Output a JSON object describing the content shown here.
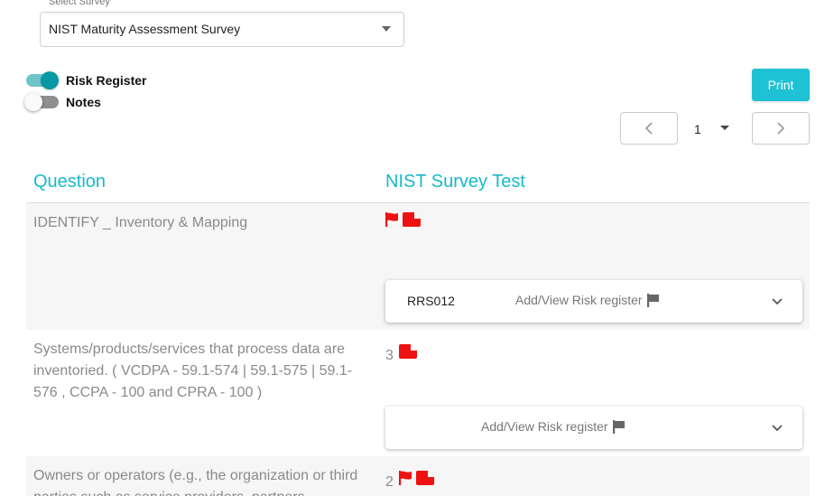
{
  "survey": {
    "label": "Select Survey",
    "selected": "NIST Maturity Assessment Survey"
  },
  "toggles": [
    {
      "label": "Risk Register",
      "on": true
    },
    {
      "label": "Notes",
      "on": false
    }
  ],
  "print_label": "Print",
  "pagination": {
    "current": "1"
  },
  "table": {
    "col_question": "Question",
    "col_survey": "NIST Survey Test",
    "rows": [
      {
        "question": "IDENTIFY _ Inventory & Mapping",
        "answer": "",
        "icons": [
          "flag-icon",
          "file-icon"
        ],
        "risk_id": "RRS012",
        "risk_link": "Add/View Risk register"
      },
      {
        "question": "Systems/products/services that process data are inventoried. ( VCDPA - 59.1-574 | 59.1-575 | 59.1-576 , CCPA - 100 and CPRA - 100 )",
        "answer": "3",
        "icons": [
          "file-icon"
        ],
        "risk_id": "",
        "risk_link": "Add/View Risk register"
      },
      {
        "question": "Owners or operators (e.g., the organization or third parties such as service providers, partners",
        "answer": "2",
        "icons": [
          "flag-icon",
          "file-icon"
        ]
      }
    ]
  },
  "colors": {
    "accent": "#16b9cc",
    "print": "#1ec2d4",
    "toggle_on": "#0a98a4",
    "flag": "#ee1111"
  }
}
